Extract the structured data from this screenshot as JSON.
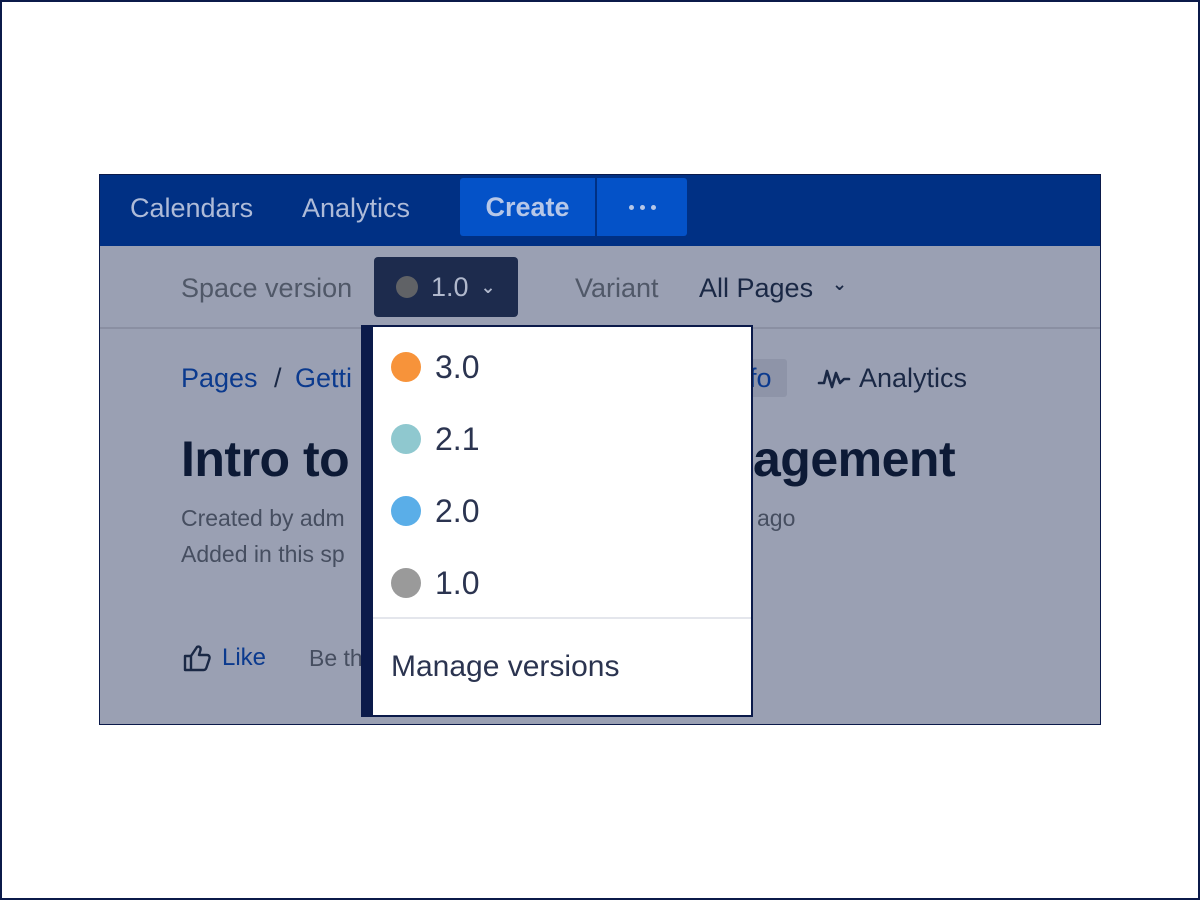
{
  "topnav": {
    "calendars": "Calendars",
    "analytics": "Analytics",
    "create": "Create"
  },
  "subheader": {
    "space_version_label": "Space version",
    "current_version": "1.0",
    "variant_label": "Variant",
    "variant_value": "All Pages"
  },
  "page": {
    "breadcrumb_pages": "Pages",
    "breadcrumb_sep": "/",
    "breadcrumb_current": "Getti",
    "info_partial": "fo",
    "analytics_link": "Analytics",
    "title_left": "Intro to",
    "title_right": "agement",
    "created_by": "Created by adm",
    "created_ago": "ago",
    "added_in": "Added in this sp",
    "like": "Like",
    "be_first": "Be th"
  },
  "dropdown": {
    "items": [
      {
        "label": "3.0",
        "color": "#f7933a"
      },
      {
        "label": "2.1",
        "color": "#8fc8cf"
      },
      {
        "label": "2.0",
        "color": "#5aaee8"
      },
      {
        "label": "1.0",
        "color": "#9a9a9a"
      }
    ],
    "manage": "Manage versions"
  }
}
